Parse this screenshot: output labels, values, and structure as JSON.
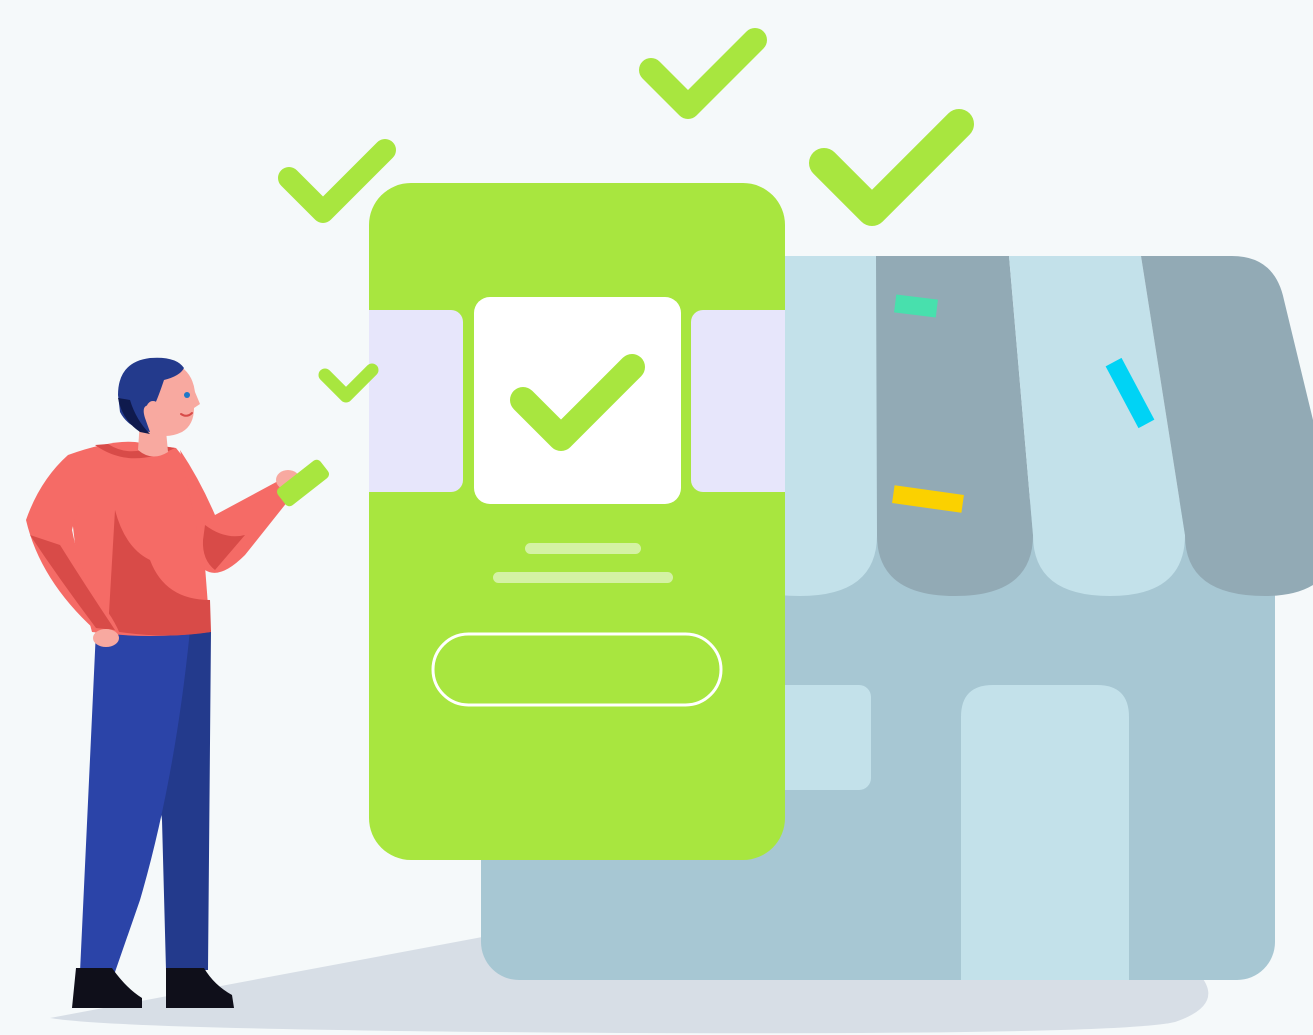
{
  "illustration": {
    "subject": "payment-success",
    "colors": {
      "background": "#f5f9fa",
      "ground": "#d7dee6",
      "accent_green": "#a8e63f",
      "store_wall": "#a7c7d3",
      "store_light": "#c3e1ea",
      "awning_dark": "#92aab5",
      "person_shirt": "#f56b66",
      "person_pants": "#2b44a8",
      "person_hair": "#233a8c",
      "confetti": [
        "#48e0ad",
        "#00d3f5",
        "#fbd100"
      ]
    },
    "icons": [
      "checkmark-icon",
      "storefront-icon",
      "phone-screen",
      "person-figure",
      "confetti"
    ]
  }
}
